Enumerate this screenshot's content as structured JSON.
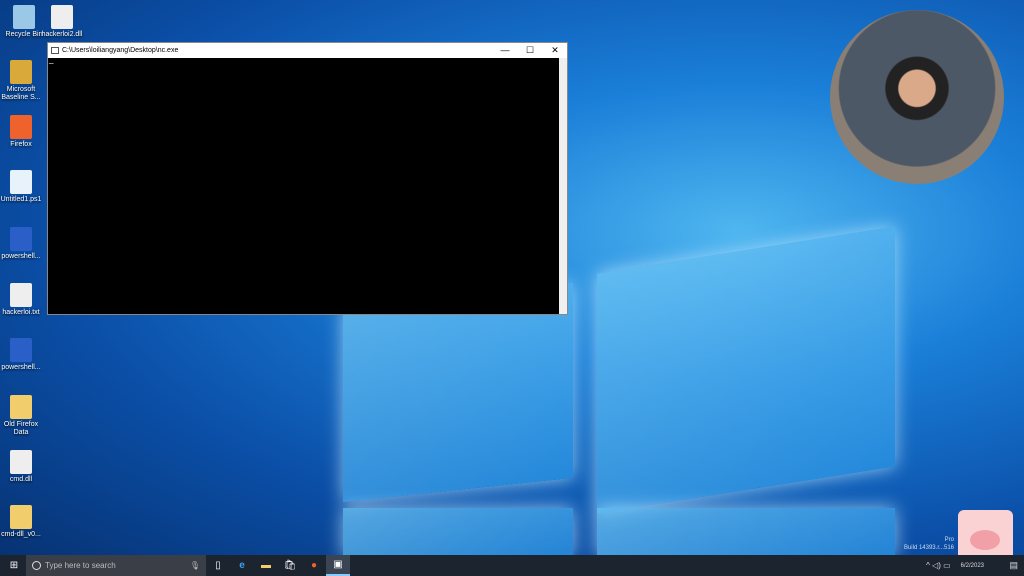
{
  "desktop_icons": [
    {
      "label": "Recycle Bin",
      "color": "#9cc8e8"
    },
    {
      "label": "hackerloi2.dll",
      "color": "#eeeeee"
    },
    {
      "label": "Microsoft Baseline S...",
      "color": "#d9a93a"
    },
    {
      "label": "Firefox",
      "color": "#f0622b"
    },
    {
      "label": "Untitled1.ps1",
      "color": "#e8f2fa"
    },
    {
      "label": "powershell...",
      "color": "#2a5fc8"
    },
    {
      "label": "hackerloi.txt",
      "color": "#eeeeee"
    },
    {
      "label": "powershell...",
      "color": "#2a5fc8"
    },
    {
      "label": "Old Firefox Data",
      "color": "#f2cd6c"
    },
    {
      "label": "cmd.dll",
      "color": "#eeeeee"
    },
    {
      "label": "cmd-dll_v0...",
      "color": "#f2cd6c"
    }
  ],
  "window": {
    "title": "C:\\Users\\loiliangyang\\Desktop\\nc.exe",
    "minimize": "—",
    "maximize": "☐",
    "close": "✕",
    "cursor": "_"
  },
  "taskbar": {
    "search_placeholder": "Type here to search",
    "date": "6/2/2023",
    "tray": "^ ◁) ▭"
  },
  "watermark": {
    "line1": "Pro",
    "line2": "Build 14393.r...516"
  }
}
